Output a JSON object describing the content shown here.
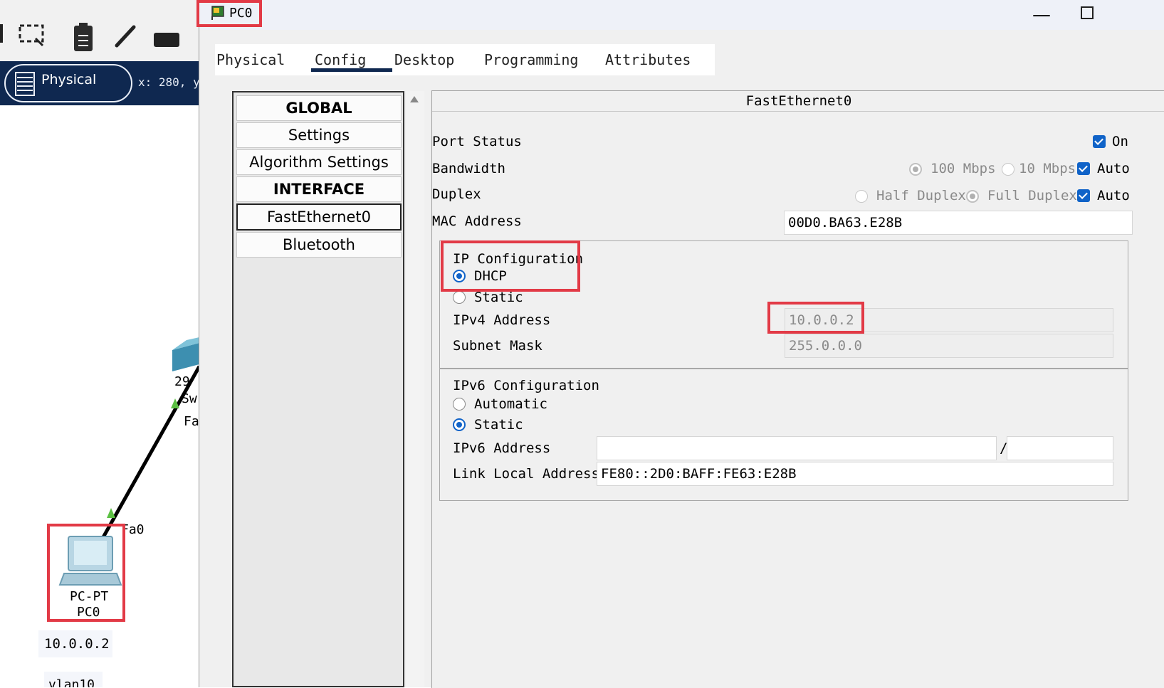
{
  "workspace": {
    "mode_label": "Physical",
    "coords": "x: 280, y:",
    "switch_label_1": "29",
    "switch_label_2": "Sw",
    "switch_port": "Fa",
    "pc_port": "Fa0",
    "pc_type": "PC-PT",
    "pc_name": "PC0",
    "pc_ip": "10.0.0.2",
    "pc_vlan": "vlan10"
  },
  "window": {
    "title": "PC0"
  },
  "tabs": [
    "Physical",
    "Config",
    "Desktop",
    "Programming",
    "Attributes"
  ],
  "active_tab": "Config",
  "sidebar": {
    "items": [
      {
        "label": "GLOBAL",
        "type": "header"
      },
      {
        "label": "Settings",
        "type": "item"
      },
      {
        "label": "Algorithm Settings",
        "type": "item"
      },
      {
        "label": "INTERFACE",
        "type": "header"
      },
      {
        "label": "FastEthernet0",
        "type": "selected"
      },
      {
        "label": "Bluetooth",
        "type": "item"
      }
    ]
  },
  "panel": {
    "title": "FastEthernet0",
    "port_status": {
      "label": "Port Status",
      "on_label": "On",
      "on": true
    },
    "bandwidth": {
      "label": "Bandwidth",
      "opt1": "100 Mbps",
      "opt2": "10 Mbps",
      "auto_label": "Auto",
      "auto": true
    },
    "duplex": {
      "label": "Duplex",
      "opt1": "Half Duplex",
      "opt2": "Full Duplex",
      "auto_label": "Auto",
      "auto": true
    },
    "mac": {
      "label": "MAC Address",
      "value": "00D0.BA63.E28B"
    },
    "ipv4": {
      "section_label": "IP Configuration",
      "dhcp_label": "DHCP",
      "static_label": "Static",
      "mode": "DHCP",
      "address_label": "IPv4 Address",
      "address_value": "10.0.0.2",
      "mask_label": "Subnet Mask",
      "mask_value": "255.0.0.0"
    },
    "ipv6": {
      "section_label": "IPv6 Configuration",
      "automatic_label": "Automatic",
      "static_label": "Static",
      "mode": "Static",
      "address_label": "IPv6 Address",
      "address_value": "",
      "prefix_sep": "/",
      "prefix_value": "",
      "link_local_label": "Link Local Address:",
      "link_local_value": "FE80::2D0:BAFF:FE63:E28B"
    }
  },
  "colors": {
    "accent": "#1063c8",
    "navy": "#0f2850",
    "highlight": "#e23a46"
  }
}
